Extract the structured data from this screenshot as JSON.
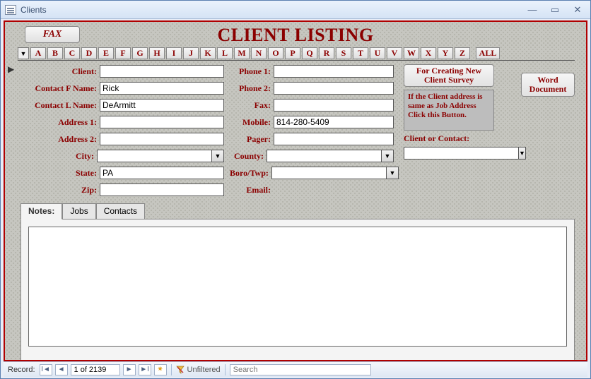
{
  "window": {
    "title": "Clients"
  },
  "header": {
    "fax_label": "FAX",
    "heading": "CLIENT LISTING"
  },
  "alpha": {
    "letters": [
      "A",
      "B",
      "C",
      "D",
      "E",
      "F",
      "G",
      "H",
      "I",
      "J",
      "K",
      "L",
      "M",
      "N",
      "O",
      "P",
      "Q",
      "R",
      "S",
      "T",
      "U",
      "V",
      "W",
      "X",
      "Y",
      "Z"
    ],
    "all_label": "ALL"
  },
  "labels": {
    "client": "Client:",
    "contact_f": "Contact F Name:",
    "contact_l": "Contact L Name:",
    "address1": "Address 1:",
    "address2": "Address 2:",
    "city": "City:",
    "state": "State:",
    "zip": "Zip:",
    "phone1": "Phone 1:",
    "phone2": "Phone 2:",
    "fax": "Fax:",
    "mobile": "Mobile:",
    "pager": "Pager:",
    "county": "County:",
    "borotwp": "Boro/Twp:",
    "email": "Email:",
    "client_or_contact": "Client or Contact:"
  },
  "values": {
    "client": "",
    "contact_f": "Rick",
    "contact_l": "DeArmitt",
    "address1": "",
    "address2": "",
    "city": "",
    "state": "PA",
    "zip": "",
    "phone1": "",
    "phone2": "",
    "fax": "",
    "mobile": "814-280-5409",
    "pager": "",
    "county": "",
    "borotwp": "",
    "email": "",
    "client_or_contact": "",
    "notes": ""
  },
  "buttons": {
    "survey": "For Creating New Client Survey",
    "word": "Word Document"
  },
  "hint": "If the Client address is same as Job Address Click this Button.",
  "tabs": {
    "notes": "Notes:",
    "jobs": "Jobs",
    "contacts": "Contacts"
  },
  "nav": {
    "label": "Record:",
    "position": "1 of 2139",
    "filter": "Unfiltered",
    "search_placeholder": "Search"
  }
}
